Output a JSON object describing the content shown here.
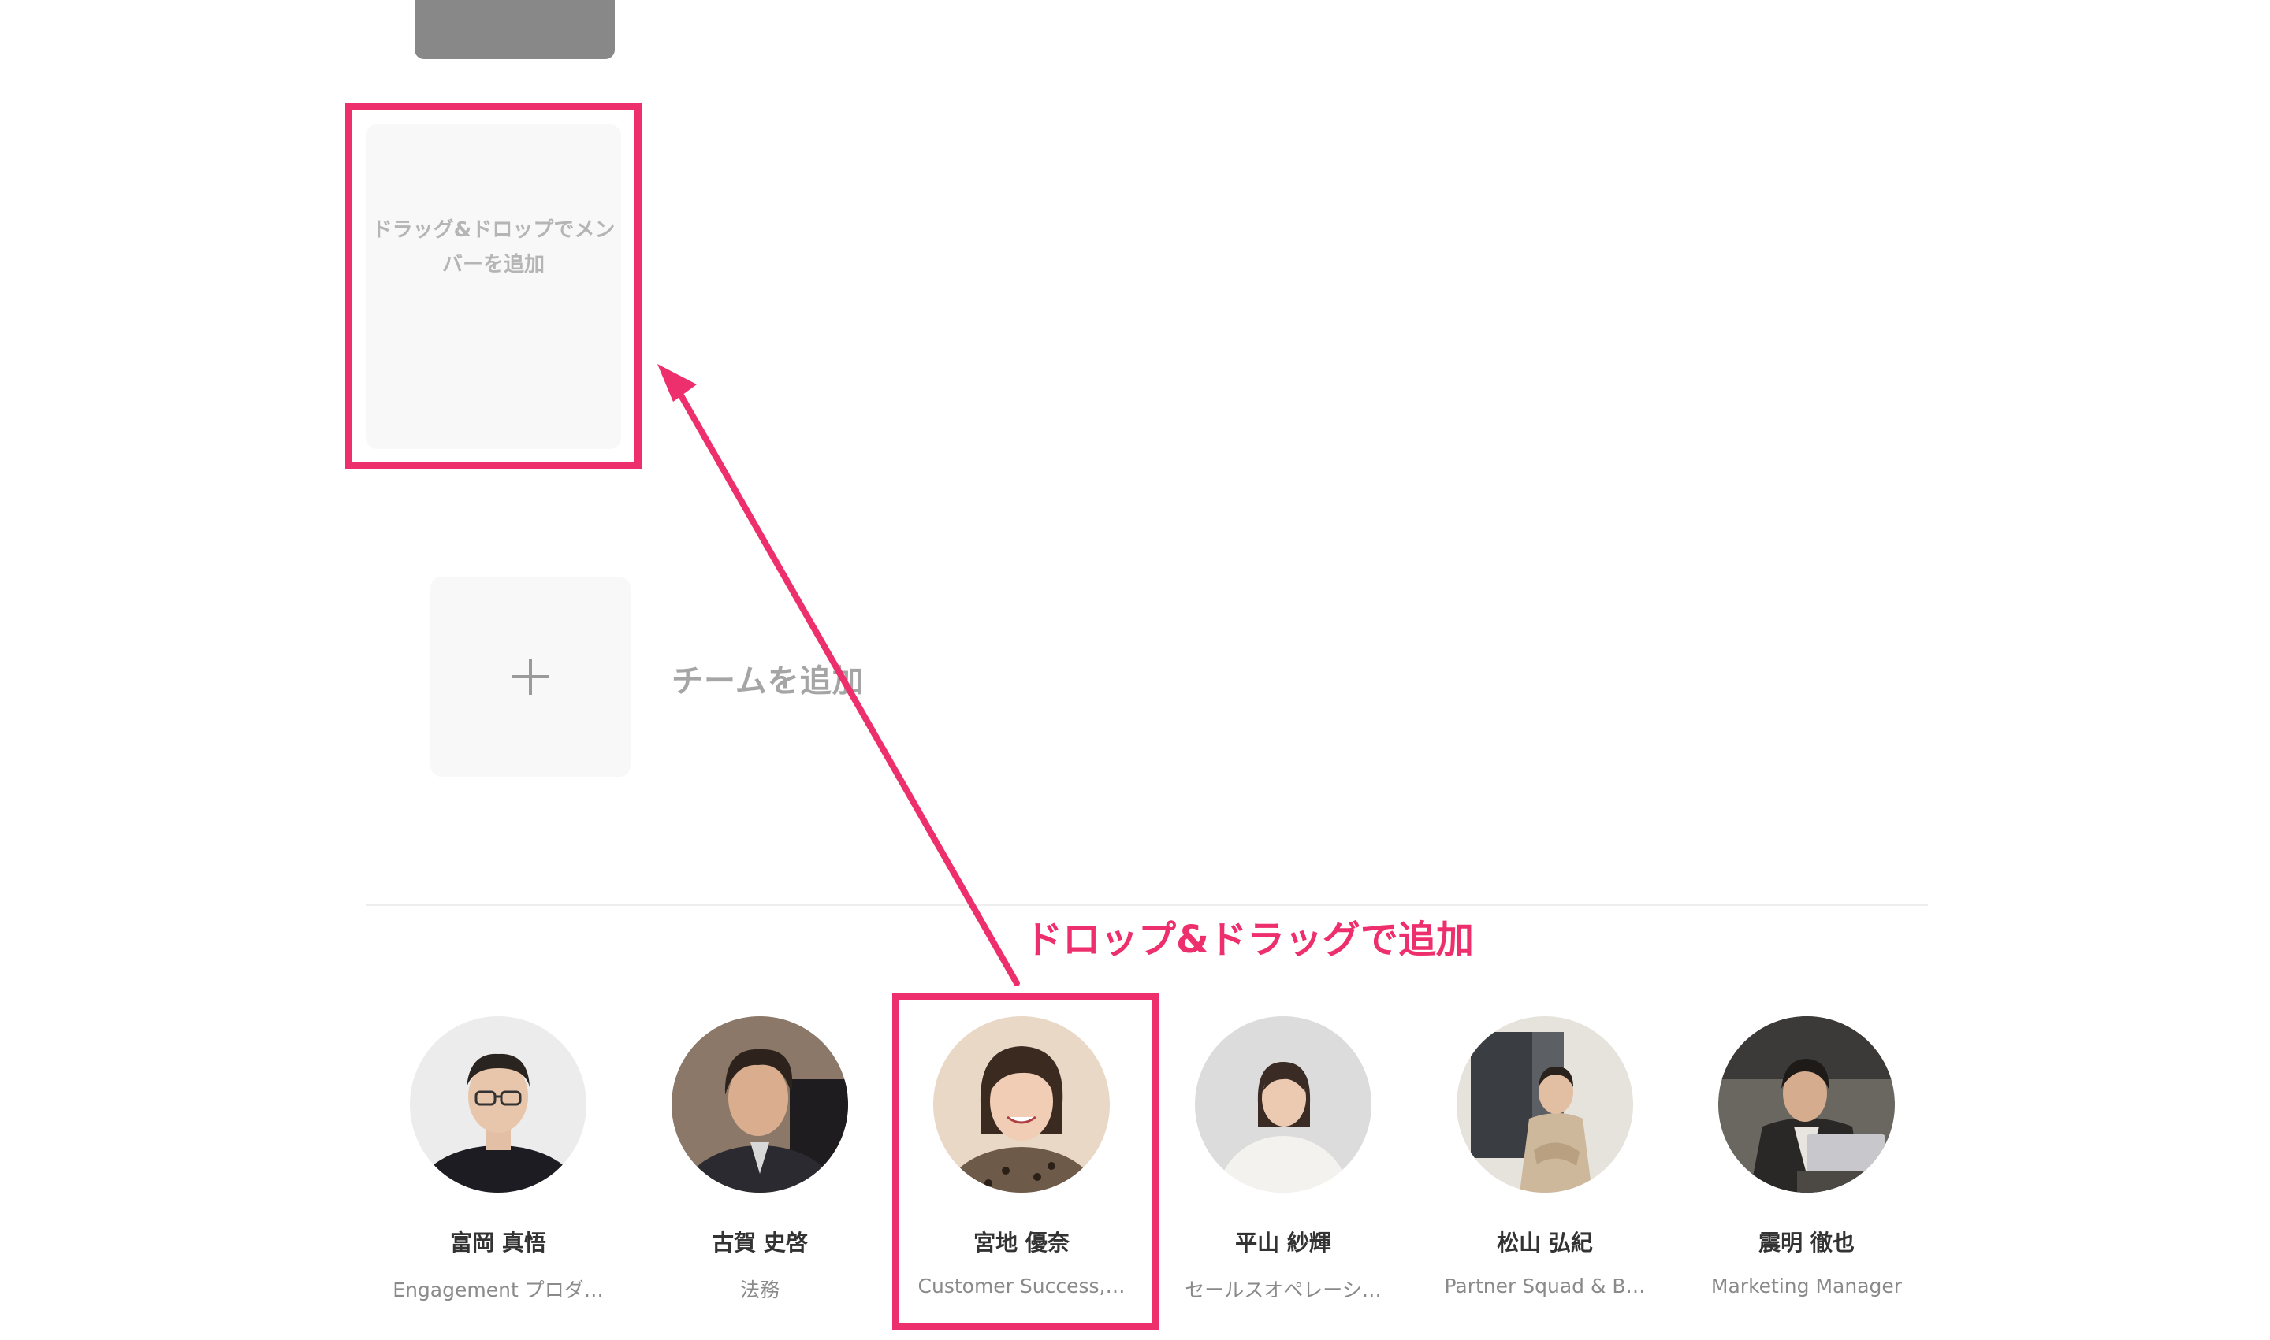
{
  "board": {
    "drop_zone_text": "ドラッグ&ドロップでメンバーを追加",
    "add_team_label": "チームを追加"
  },
  "annotation": {
    "label": "ドロップ&ドラッグで追加",
    "color": "#ee2f6d"
  },
  "members": [
    {
      "name": "富岡 真悟",
      "role": "Engagement プロダ…",
      "photo": "man-glasses-dark-sweater"
    },
    {
      "name": "古賀 史啓",
      "role": "法務",
      "photo": "man-dark-hoodie"
    },
    {
      "name": "宮地 優奈",
      "role": "Customer Success,…",
      "photo": "woman-leopard-blouse"
    },
    {
      "name": "平山 紗輝",
      "role": "セールスオペレーシ…",
      "photo": "woman-white-cardigan"
    },
    {
      "name": "松山 弘紀",
      "role": "Partner Squad & B…",
      "photo": "man-beige-jacket-office"
    },
    {
      "name": "震明 徹也",
      "role": "Marketing Manager",
      "photo": "man-laptop-cafe"
    }
  ]
}
